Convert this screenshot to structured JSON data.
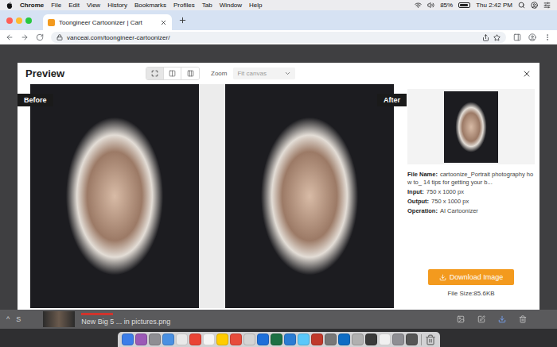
{
  "menu_bar": {
    "app": "Chrome",
    "items": [
      "File",
      "Edit",
      "View",
      "History",
      "Bookmarks",
      "Profiles",
      "Tab",
      "Window",
      "Help"
    ],
    "battery": {
      "reading": "85%",
      "level": 0.85
    },
    "clock": "Thu 2:42 PM"
  },
  "browser": {
    "tabs": [
      {
        "title": "Toongineer Cartoonizer | Cart",
        "selected": true
      }
    ],
    "url": "vanceai.com/toongineer-cartoonizer/"
  },
  "preview": {
    "title": "Preview",
    "views": [
      {
        "kind": "fit",
        "selected": true
      },
      {
        "kind": "split",
        "selected": false
      },
      {
        "kind": "side",
        "selected": false
      }
    ],
    "zoom": {
      "label": "Zoom",
      "placeholder": "Fit canvas"
    },
    "before_label": "Before",
    "after_label": "After",
    "details": [
      {
        "label": "File Name:",
        "value": "cartoonize_Portrait photography how to_ 14 tips for getting your b..."
      },
      {
        "label": "Input:",
        "value": "750 x 1000 px"
      },
      {
        "label": "Output:",
        "value": "750 x 1000 px"
      },
      {
        "label": "Operation:",
        "value": "AI Cartoonizer"
      }
    ],
    "download_button": "Download Image",
    "file_size": "File Size:85.6KB"
  },
  "download_shelf": {
    "toggle": "^",
    "partial": "S",
    "file": "New Big 5 ... in pictures.png"
  }
}
